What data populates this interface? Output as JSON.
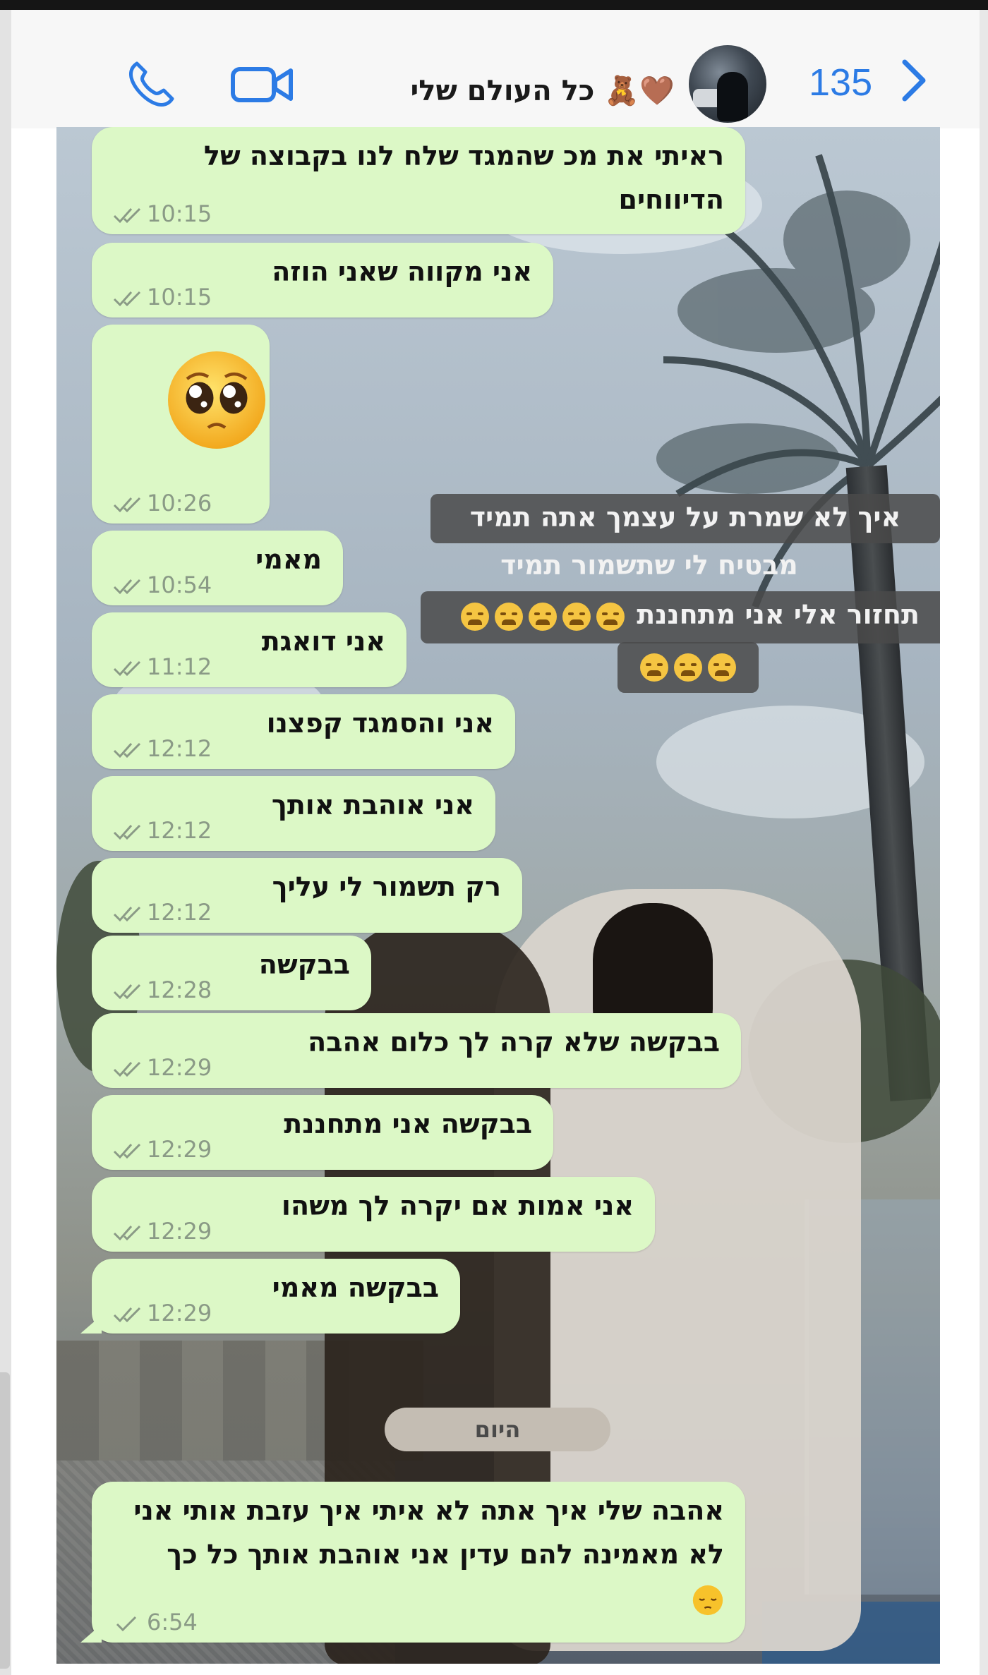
{
  "header": {
    "back_count": "135",
    "contact_name": "כל העולם שלי 🧸🤎",
    "name_emoji_colors": [
      "#8b5a2b",
      "#c08a4a"
    ]
  },
  "icons": {
    "back": "chevron-left-icon",
    "avatar": "contact-avatar",
    "video": "video-camera-icon",
    "phone": "phone-icon",
    "ticks": "double-check-icon",
    "single_tick": "check-icon"
  },
  "accent_color": "#2c7be5",
  "bubble_color": "#dcf8c6",
  "messages": [
    {
      "text": "ראיתי את מכ שהמגד שלח לנו בקבוצה של הדיווחים",
      "time": "10:15"
    },
    {
      "text": "אני מקווה שאני הוזה",
      "time": "10:15"
    },
    {
      "text": "🥺",
      "time": "10:26"
    },
    {
      "text": "מאמי",
      "time": "10:54"
    },
    {
      "text": "אני דואגת",
      "time": "11:12"
    },
    {
      "text": "אני והסמגד קפצנו",
      "time": "12:12"
    },
    {
      "text": "אני אוהבת אותך",
      "time": "12:12"
    },
    {
      "text": "רק תשמור לי עליך",
      "time": "12:12"
    },
    {
      "text": "בבקשה",
      "time": "12:28"
    },
    {
      "text": "בבקשה שלא קרה לך כלום אהבה",
      "time": "12:29"
    },
    {
      "text": "בבקשה אני מתחננת",
      "time": "12:29"
    },
    {
      "text": "אני אמות אם יקרה לך משהו",
      "time": "12:29"
    },
    {
      "text": "בבקשה מאמי",
      "time": "12:29"
    },
    {
      "text": "אהבה שלי איך אתה לא איתי איך עזבת אותי אני לא מאמינה להם עדין אני אוהבת אותך כל כך",
      "time": "6:54"
    }
  ],
  "date_divider": "היום",
  "caption": {
    "line1": "איך לא שמרת על עצמך אתה תמיד",
    "line2": "מבטיח לי שתשמור תמיד",
    "line3": "תחזור אלי אני מתחננת",
    "line3_emoji_count": 5,
    "line4_emoji_count": 3
  }
}
